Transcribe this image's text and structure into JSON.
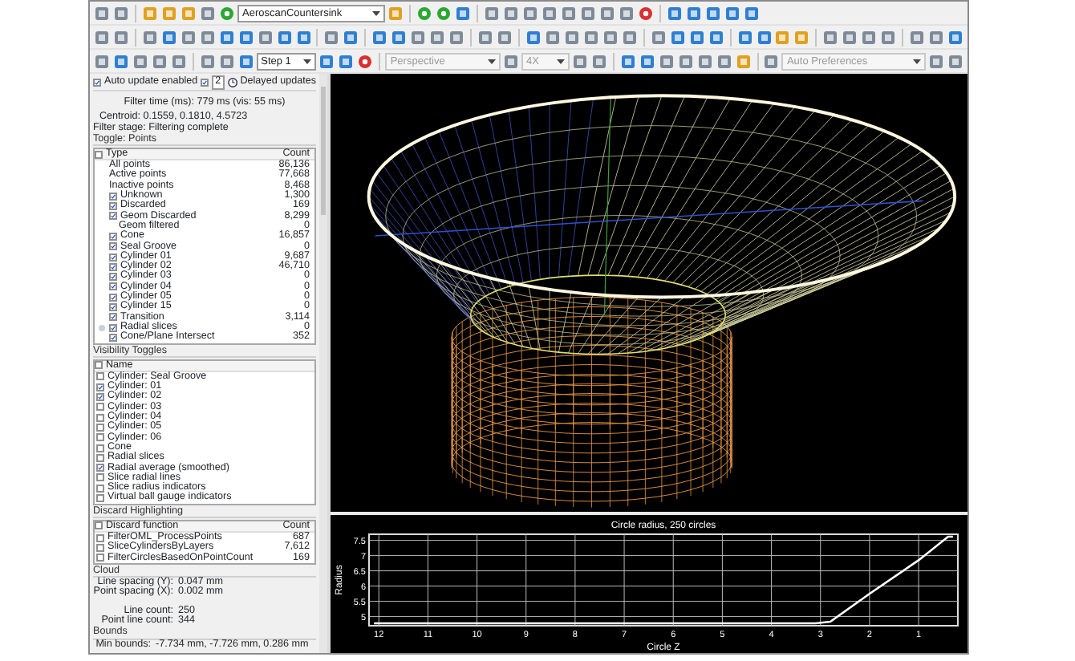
{
  "toolbar": {
    "dataset_select": {
      "value": "AeroscanCountersink",
      "disabled": false
    },
    "step_select": {
      "value": "Step 1",
      "disabled": false
    },
    "projection_select": {
      "value": "Perspective",
      "disabled": true
    },
    "zoom_select": {
      "value": "4X",
      "disabled": true
    },
    "preferences_select": {
      "value": "Auto Preferences",
      "disabled": true
    }
  },
  "filter_panel": {
    "auto_update": {
      "label": "Auto update enabled",
      "checked": true
    },
    "delayed_updates": {
      "checked": true,
      "value": "2",
      "label": "Delayed updates"
    },
    "filter_time": "Filter time (ms): 779 ms (vis: 55 ms)",
    "centroid": "Centroid: 0.1559, 0.1810, 4.5723",
    "filter_stage": "Filter stage: Filtering complete",
    "points_group": {
      "title": "Toggle: Points",
      "header_checked": false,
      "columns": [
        "Type",
        "Count"
      ],
      "rows": [
        {
          "name": "All points",
          "count": "86,136",
          "kind": "summary"
        },
        {
          "name": "Active points",
          "count": "77,668",
          "kind": "summary"
        },
        {
          "name": "Inactive points",
          "count": "8,468",
          "kind": "summary"
        },
        {
          "name": "Unknown",
          "count": "1,300",
          "kind": "toggle",
          "checked": true
        },
        {
          "name": "Discarded",
          "count": "169",
          "kind": "toggle",
          "checked": true
        },
        {
          "name": "Geom Discarded",
          "count": "8,299",
          "kind": "toggle",
          "checked": true
        },
        {
          "name": "Geom filtered",
          "count": "0",
          "kind": "summary"
        },
        {
          "name": "Cone",
          "count": "16,857",
          "kind": "toggle",
          "checked": true
        },
        {
          "name": "Seal Groove",
          "count": "0",
          "kind": "toggle",
          "checked": true
        },
        {
          "name": "Cylinder 01",
          "count": "9,687",
          "kind": "toggle",
          "checked": true
        },
        {
          "name": "Cylinder 02",
          "count": "46,710",
          "kind": "toggle",
          "checked": true
        },
        {
          "name": "Cylinder 03",
          "count": "0",
          "kind": "toggle",
          "checked": true
        },
        {
          "name": "Cylinder 04",
          "count": "0",
          "kind": "toggle",
          "checked": true
        },
        {
          "name": "Cylinder 05",
          "count": "0",
          "kind": "toggle",
          "checked": true
        },
        {
          "name": "Cylinder 15",
          "count": "0",
          "kind": "toggle",
          "checked": true
        },
        {
          "name": "Transition",
          "count": "3,114",
          "kind": "toggle",
          "checked": true
        },
        {
          "name": "Radial slices",
          "count": "0",
          "kind": "expandable",
          "checked": true
        },
        {
          "name": "Cone/Plane Intersect",
          "count": "352",
          "kind": "toggle",
          "checked": true
        }
      ]
    },
    "visibility_group": {
      "title": "Visibility Toggles",
      "header_checked": false,
      "columns": [
        "Name"
      ],
      "rows": [
        {
          "name": "Cylinder: Seal Groove",
          "checked": false
        },
        {
          "name": "Cylinder: 01",
          "checked": true
        },
        {
          "name": "Cylinder: 02",
          "checked": true
        },
        {
          "name": "Cylinder: 03",
          "checked": false
        },
        {
          "name": "Cylinder: 04",
          "checked": false
        },
        {
          "name": "Cylinder: 05",
          "checked": false
        },
        {
          "name": "Cylinder: 06",
          "checked": false
        },
        {
          "name": "Cone",
          "checked": false
        },
        {
          "name": "Radial slices",
          "checked": false
        },
        {
          "name": "Radial average (smoothed)",
          "checked": true
        },
        {
          "name": "Slice radial lines",
          "checked": false
        },
        {
          "name": "Slice radius indicators",
          "checked": false
        },
        {
          "name": "Virtual ball gauge indicators",
          "checked": false
        }
      ]
    },
    "discard_group": {
      "title": "Discard Highlighting",
      "header_checked": false,
      "columns": [
        "Discard function",
        "Count"
      ],
      "rows": [
        {
          "name": "FilterOML_ProcessPoints",
          "count": "687",
          "checked": false
        },
        {
          "name": "SliceCylindersByLayers",
          "count": "7,612",
          "checked": false
        },
        {
          "name": "FilterCirclesBasedOnPointCount",
          "count": "169",
          "checked": false
        }
      ]
    },
    "cloud": {
      "title": "Cloud",
      "spacing": [
        {
          "label": "Line spacing (Y):",
          "value": "0.047 mm"
        },
        {
          "label": "Point spacing (X):",
          "value": "0.002 mm"
        }
      ],
      "counts": [
        {
          "label": "Line count:",
          "value": "250"
        },
        {
          "label": "Point line count:",
          "value": "344"
        }
      ]
    },
    "bounds": {
      "title": "Bounds",
      "rows": [
        {
          "label": "Min bounds:",
          "value": "-7.734 mm, -7.726 mm, 0.286 mm"
        }
      ]
    }
  },
  "chart": {
    "chart_data": {
      "type": "line",
      "title": "Circle radius, 250 circles",
      "xlabel": "Circle Z",
      "ylabel": "Radius",
      "x": [
        12.1,
        11.7,
        6,
        3.1,
        2.8,
        2,
        1,
        0.4,
        0.3
      ],
      "series": [
        {
          "color": "#ffffff",
          "values": [
            4.78,
            4.78,
            4.78,
            4.78,
            4.83,
            5.75,
            6.85,
            7.62,
            7.62
          ]
        }
      ],
      "grid": true,
      "xlim": [
        12.2,
        0.2
      ],
      "ylim": [
        4.7,
        7.7
      ],
      "xticks": [
        12,
        11,
        10,
        9,
        8,
        7,
        6,
        5,
        4,
        3,
        2,
        1
      ],
      "yticks": [
        5,
        5.5,
        6,
        6.5,
        7,
        7.5
      ]
    }
  }
}
